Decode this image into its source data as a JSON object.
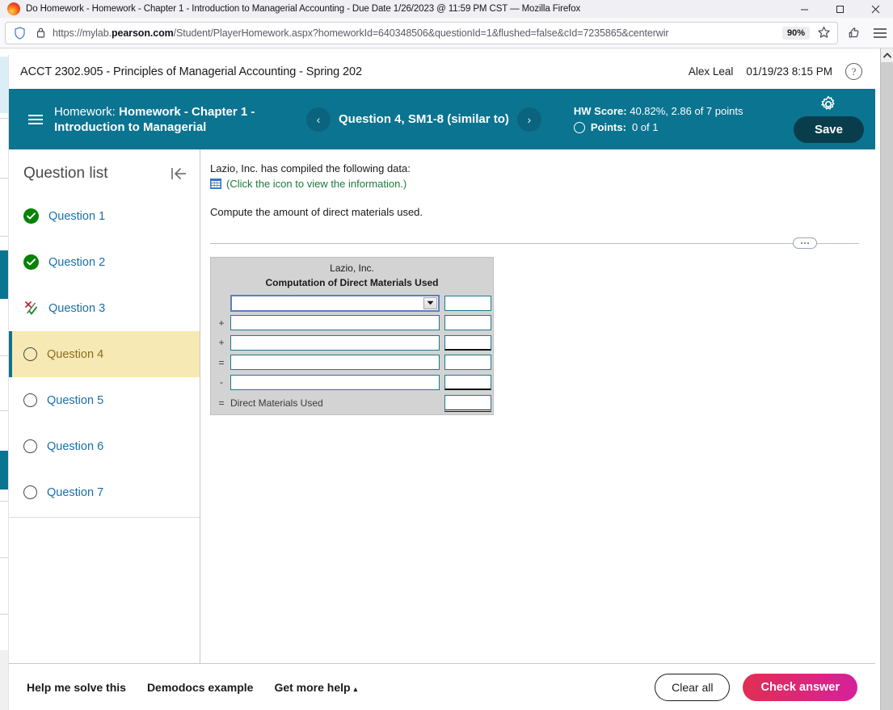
{
  "browser": {
    "tab_title": "Do Homework - Homework - Chapter 1 - Introduction to Managerial Accounting - Due Date 1/26/2023 @ 11:59 PM CST — Mozilla Firefox",
    "url_prefix": "https://mylab.",
    "url_domain": "pearson.com",
    "url_suffix": "/Student/PlayerHomework.aspx?homeworkId=640348506&questionId=1&flushed=false&cId=7235865&centerwir",
    "zoom_level": "90%",
    "minimize_label": "Minimize",
    "maximize_label": "Maximize",
    "close_label": "Close"
  },
  "course_bar": {
    "course_title": "ACCT 2302.905 - Principles of Managerial Accounting - Spring 202",
    "student_name": "Alex Leal",
    "timestamp": "01/19/23 8:15 PM",
    "help_glyph": "?"
  },
  "homework_bar": {
    "title_label": "Homework:",
    "title_value": "Homework - Chapter 1 - Introduction to Managerial",
    "prev_glyph": "‹",
    "next_glyph": "›",
    "question_nav_label": "Question 4, SM1-8 (similar to)",
    "hw_score_label": "HW Score:",
    "hw_score_value": "40.82%, 2.86 of 7 points",
    "points_label": "Points:",
    "points_value": "0 of 1",
    "save_label": "Save",
    "accent_color": "#0b7491",
    "save_color": "#0a3d4c"
  },
  "question_list": {
    "title": "Question list",
    "collapse_name": "collapse-panel",
    "items": [
      {
        "label": "Question 1",
        "status": "correct"
      },
      {
        "label": "Question 2",
        "status": "correct"
      },
      {
        "label": "Question 3",
        "status": "partial"
      },
      {
        "label": "Question 4",
        "status": "blank",
        "active": true
      },
      {
        "label": "Question 5",
        "status": "blank"
      },
      {
        "label": "Question 6",
        "status": "blank"
      },
      {
        "label": "Question 7",
        "status": "blank"
      }
    ]
  },
  "question": {
    "intro": "Lazio, Inc. has compiled the following data:",
    "data_link": "(Click the icon to view the information.)",
    "data_link_color": "#1d7a3a",
    "prompt": "Compute the amount of direct materials used."
  },
  "worksheet": {
    "company": "Lazio, Inc.",
    "subtitle": "Computation of Direct Materials Used",
    "rows": [
      {
        "op": "",
        "type": "select",
        "value": "",
        "amount": "",
        "amount_rule": "none"
      },
      {
        "op": "+",
        "type": "text",
        "value": "",
        "amount": "",
        "amount_rule": "none"
      },
      {
        "op": "+",
        "type": "text",
        "value": "",
        "amount": "",
        "amount_rule": "single"
      },
      {
        "op": "=",
        "type": "text",
        "value": "",
        "amount": "",
        "amount_rule": "none"
      },
      {
        "op": "-",
        "type": "text",
        "value": "",
        "amount": "",
        "amount_rule": "single"
      },
      {
        "op": "=",
        "type": "label",
        "value": "Direct Materials Used",
        "amount": "",
        "amount_rule": "double"
      }
    ]
  },
  "bottom_bar": {
    "help_me_solve": "Help me solve this",
    "demodocs": "Demodocs example",
    "get_more_help": "Get more help",
    "get_more_help_caret": "▴",
    "clear_all": "Clear all",
    "check_answer": "Check answer",
    "check_answer_color": "#d6219b"
  }
}
